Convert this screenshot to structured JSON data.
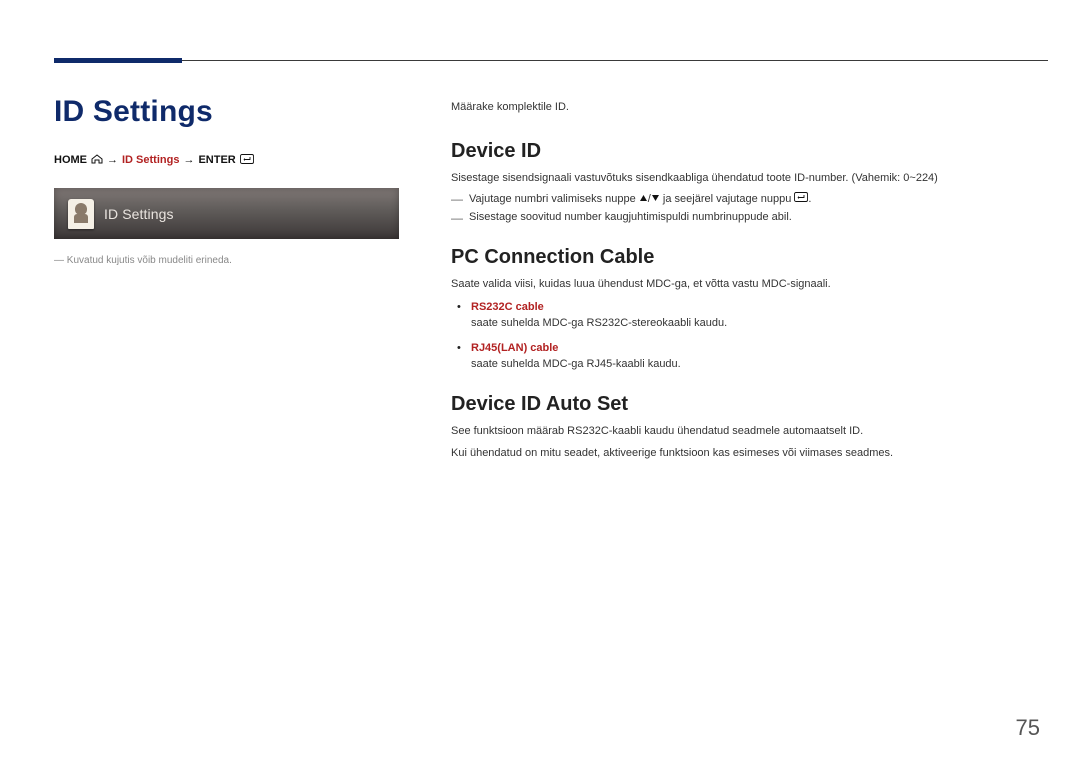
{
  "page": {
    "title": "ID Settings",
    "page_number": "75"
  },
  "breadcrumb": {
    "home": "HOME",
    "arrow": "→",
    "mid": "ID Settings",
    "enter": "ENTER"
  },
  "panel": {
    "label": "ID Settings"
  },
  "left_note": "Kuvatud kujutis võib mudeliti erineda.",
  "intro": "Määrake komplektile ID.",
  "sections": {
    "device_id": {
      "title": "Device ID",
      "desc": "Sisestage sisendsignaali vastuvõtuks sisendkaabliga ühendatud toote ID-number. (Vahemik: 0~224)",
      "note1_a": "Vajutage numbri valimiseks nuppe",
      "note1_b": "/",
      "note1_c": "ja seejärel vajutage nuppu",
      "note1_d": ".",
      "note2": "Sisestage soovitud number kaugjuhtimispuldi numbrinuppude abil."
    },
    "pc_cable": {
      "title": "PC Connection Cable",
      "desc": "Saate valida viisi, kuidas luua ühendust MDC-ga, et võtta vastu MDC-signaali.",
      "items": [
        {
          "title": "RS232C cable",
          "desc": "saate suhelda MDC-ga RS232C-stereokaabli kaudu."
        },
        {
          "title": "RJ45(LAN) cable",
          "desc": "saate suhelda MDC-ga RJ45-kaabli kaudu."
        }
      ]
    },
    "auto_set": {
      "title": "Device ID Auto Set",
      "p1": "See funktsioon määrab RS232C-kaabli kaudu ühendatud seadmele automaatselt ID.",
      "p2": "Kui ühendatud on mitu seadet, aktiveerige funktsioon kas esimeses või viimases seadmes."
    }
  }
}
